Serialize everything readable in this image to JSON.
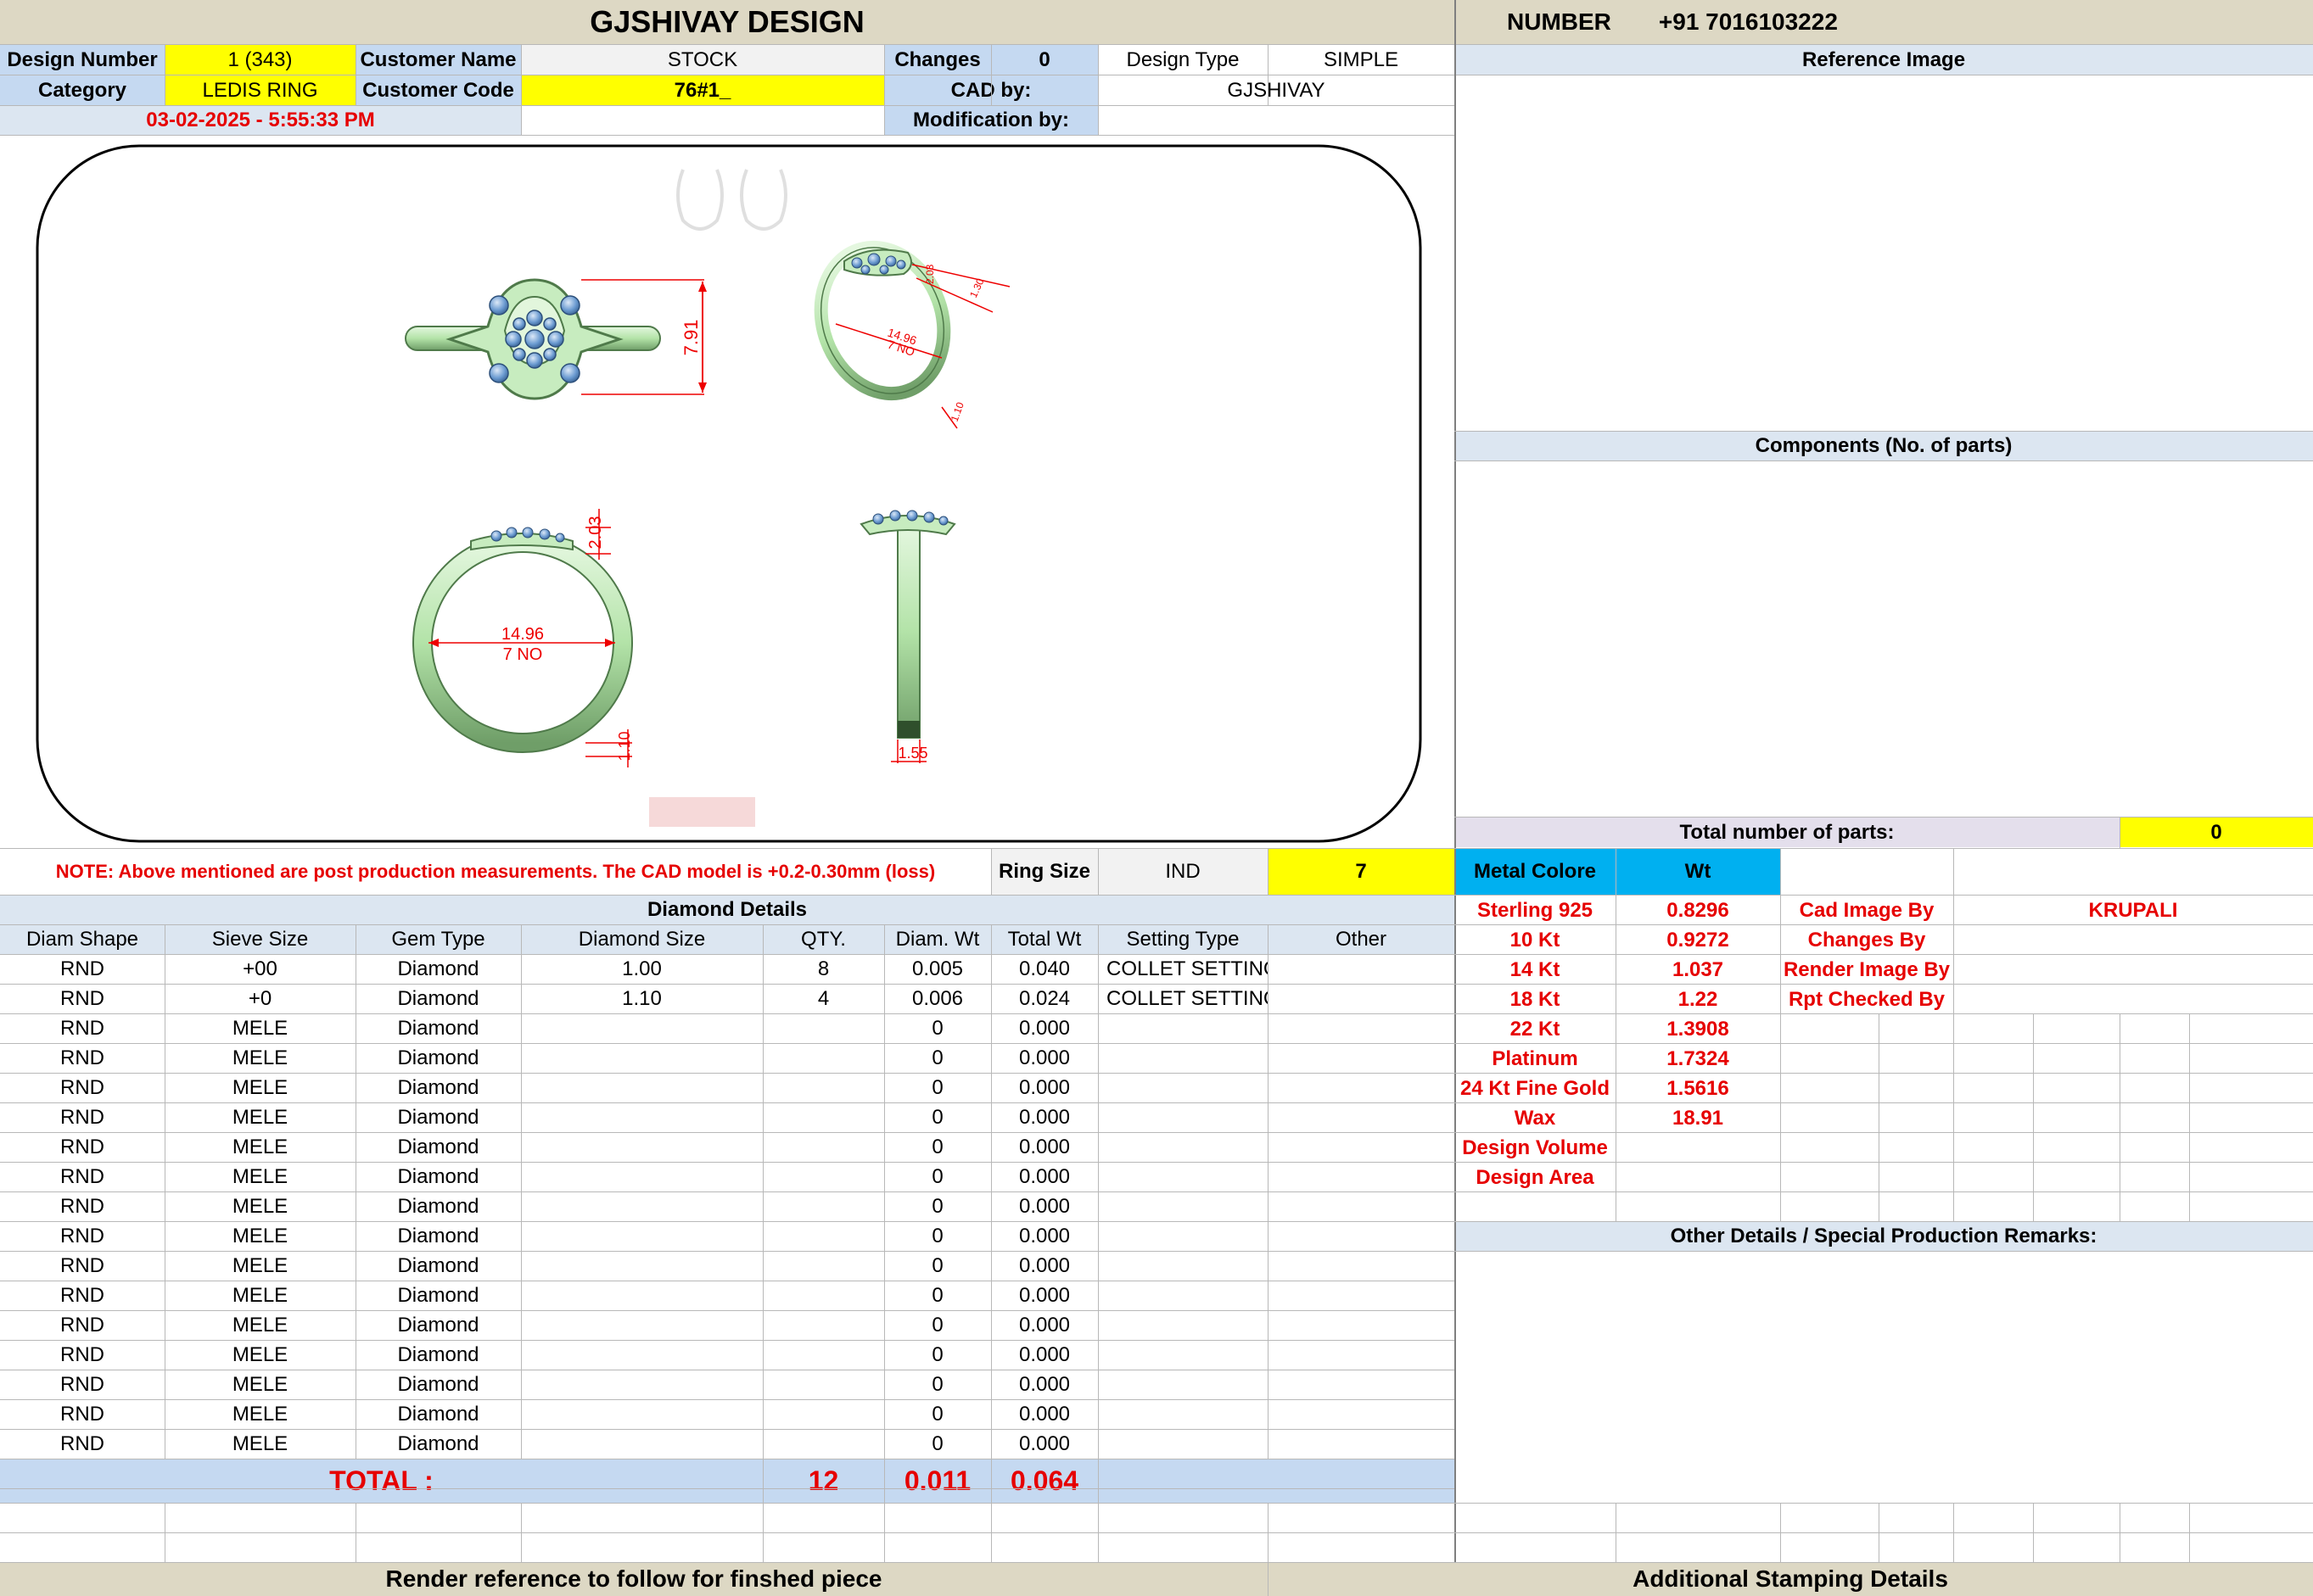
{
  "header": {
    "company": "GJSHIVAY DESIGN",
    "number_label": "NUMBER",
    "number_value": "+91 7016103222"
  },
  "info": {
    "design_number_label": "Design Number",
    "design_number": "1 (343)",
    "customer_name_label": "Customer Name",
    "customer_name": "STOCK",
    "changes_label": "Changes",
    "changes": "0",
    "design_type_label": "Design Type",
    "design_type": "SIMPLE",
    "category_label": "Category",
    "category": "LEDIS RING",
    "customer_code_label": "Customer Code",
    "customer_code": "76#1_",
    "cad_by_label": "CAD by:",
    "cad_by": "GJSHIVAY",
    "datetime": "03-02-2025 - 5:55:33 PM",
    "modification_by_label": "Modification by:",
    "modification_by": ""
  },
  "reference_image_label": "Reference Image",
  "components_label": "Components (No. of parts)",
  "total_parts_label": "Total number of parts:",
  "total_parts": "0",
  "drawing": {
    "dim_height": "7.91",
    "dim_top": "2.03",
    "dim_inner_size": "14.96",
    "dim_inner_no": "7 NO",
    "dim_band": "1.10",
    "dim_width": "1.55",
    "dim_iso_a": "14.96",
    "dim_iso_b": "7 NO",
    "dim_iso_c": "1.30",
    "dim_iso_d": "2.03",
    "dim_iso_e": "1.10"
  },
  "note": "NOTE: Above mentioned are post production measurements. The CAD model is +0.2-0.30mm (loss)",
  "ring_size": {
    "label": "Ring Size",
    "standard": "IND",
    "value": "7"
  },
  "diamond": {
    "title": "Diamond Details",
    "columns": [
      "Diam Shape",
      "Sieve Size",
      "Gem Type",
      "Diamond Size",
      "QTY.",
      "Diam. Wt",
      "Total Wt",
      "Setting Type",
      "Other"
    ],
    "rows": [
      [
        "RND",
        "+00",
        "Diamond",
        "1.00",
        "8",
        "0.005",
        "0.040",
        "COLLET SETTING",
        ""
      ],
      [
        "RND",
        "+0",
        "Diamond",
        "1.10",
        "4",
        "0.006",
        "0.024",
        "COLLET SETTING",
        ""
      ],
      [
        "RND",
        "MELE",
        "Diamond",
        "",
        "",
        "0",
        "0.000",
        "",
        ""
      ],
      [
        "RND",
        "MELE",
        "Diamond",
        "",
        "",
        "0",
        "0.000",
        "",
        ""
      ],
      [
        "RND",
        "MELE",
        "Diamond",
        "",
        "",
        "0",
        "0.000",
        "",
        ""
      ],
      [
        "RND",
        "MELE",
        "Diamond",
        "",
        "",
        "0",
        "0.000",
        "",
        ""
      ],
      [
        "RND",
        "MELE",
        "Diamond",
        "",
        "",
        "0",
        "0.000",
        "",
        ""
      ],
      [
        "RND",
        "MELE",
        "Diamond",
        "",
        "",
        "0",
        "0.000",
        "",
        ""
      ],
      [
        "RND",
        "MELE",
        "Diamond",
        "",
        "",
        "0",
        "0.000",
        "",
        ""
      ],
      [
        "RND",
        "MELE",
        "Diamond",
        "",
        "",
        "0",
        "0.000",
        "",
        ""
      ],
      [
        "RND",
        "MELE",
        "Diamond",
        "",
        "",
        "0",
        "0.000",
        "",
        ""
      ],
      [
        "RND",
        "MELE",
        "Diamond",
        "",
        "",
        "0",
        "0.000",
        "",
        ""
      ],
      [
        "RND",
        "MELE",
        "Diamond",
        "",
        "",
        "0",
        "0.000",
        "",
        ""
      ],
      [
        "RND",
        "MELE",
        "Diamond",
        "",
        "",
        "0",
        "0.000",
        "",
        ""
      ],
      [
        "RND",
        "MELE",
        "Diamond",
        "",
        "",
        "0",
        "0.000",
        "",
        ""
      ],
      [
        "RND",
        "MELE",
        "Diamond",
        "",
        "",
        "0",
        "0.000",
        "",
        ""
      ],
      [
        "RND",
        "MELE",
        "Diamond",
        "",
        "",
        "0",
        "0.000",
        "",
        ""
      ]
    ],
    "total_label": "TOTAL :",
    "total_qty": "12",
    "total_diam_wt": "0.011",
    "total_wt": "0.064"
  },
  "metal": {
    "header_label": "Metal Colore",
    "header_wt": "Wt",
    "rows": [
      {
        "name": "Sterling 925",
        "wt": "0.8296"
      },
      {
        "name": "10 Kt",
        "wt": "0.9272"
      },
      {
        "name": "14 Kt",
        "wt": "1.037"
      },
      {
        "name": "18 Kt",
        "wt": "1.22"
      },
      {
        "name": "22 Kt",
        "wt": "1.3908"
      },
      {
        "name": "Platinum",
        "wt": "1.7324"
      },
      {
        "name": "24 Kt Fine Gold",
        "wt": "1.5616"
      },
      {
        "name": "Wax",
        "wt": "18.91"
      },
      {
        "name": "Design Volume",
        "wt": ""
      },
      {
        "name": "Design Area",
        "wt": ""
      }
    ]
  },
  "credits": [
    {
      "label": "Cad Image By",
      "value": "KRUPALI"
    },
    {
      "label": "Changes By",
      "value": ""
    },
    {
      "label": "Render Image By",
      "value": ""
    },
    {
      "label": "Rpt Checked By",
      "value": ""
    }
  ],
  "other_details_label": "Other Details / Special Production Remarks:",
  "footer": {
    "render_reference": "Render reference to follow for finshed piece",
    "stamping": "Additional Stamping Details"
  },
  "colors": {
    "header_tan": "#ddd8c4",
    "label_blue": "#c5d9f1",
    "highlight_yellow": "#ffff00",
    "metal_cyan": "#00b0f0",
    "red_text": "#e60000",
    "ring_green": "#b8e6b0",
    "stone_blue": "#6b9bd1"
  }
}
